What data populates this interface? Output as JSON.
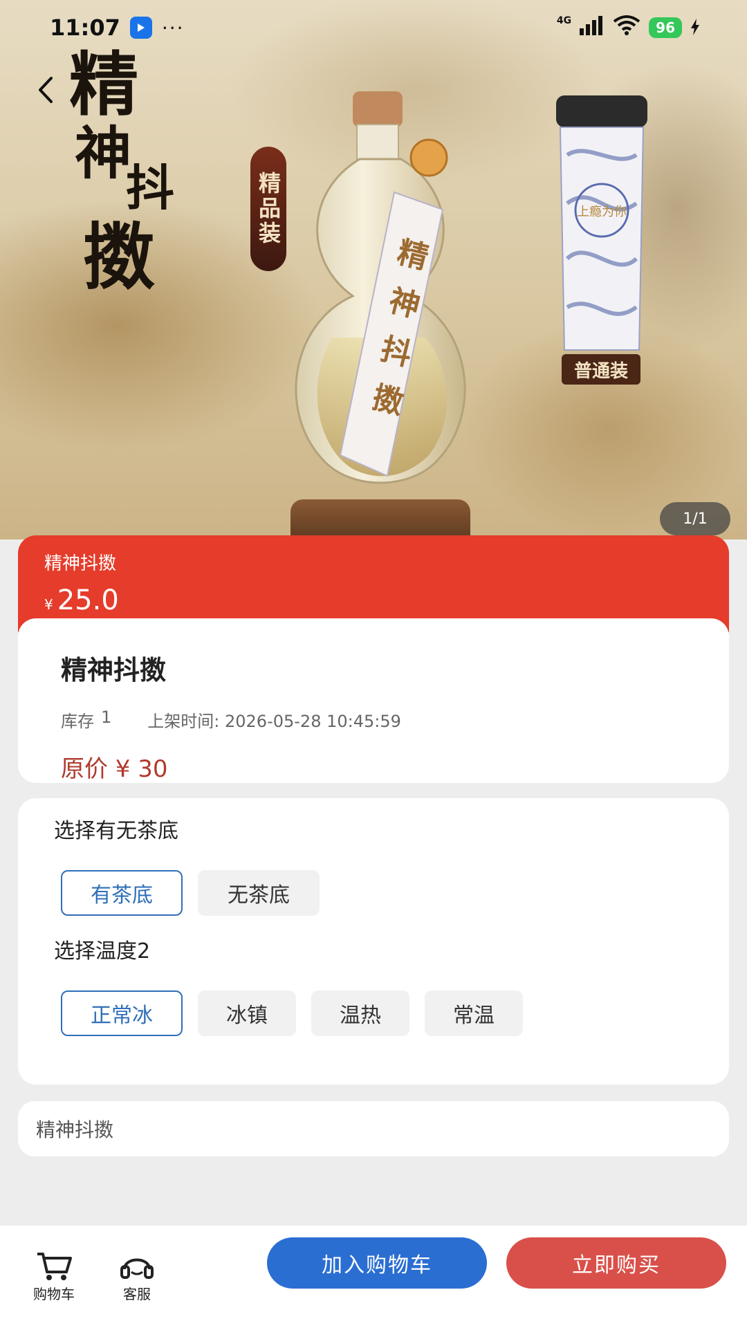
{
  "status_bar": {
    "time": "11:07",
    "dots": "···",
    "network": "4G",
    "battery": "96"
  },
  "hero": {
    "calligraphy_title": [
      "精",
      "神",
      "抖",
      "擞"
    ],
    "premium_tag": "精品装",
    "normal_tag": "普通装",
    "image_counter": "1/1"
  },
  "price_banner": {
    "name": "精神抖擞",
    "currency": "¥",
    "price": "25.0"
  },
  "product": {
    "title": "精神抖擞",
    "stock_label": "库存",
    "stock_value": "1",
    "listing_time": "上架时间: 2026-05-28 10:45:59",
    "original_price": "原价 ¥ 30"
  },
  "options": {
    "tea_base": {
      "title": "选择有无茶底",
      "choices": [
        "有茶底",
        "无茶底"
      ],
      "selected": 0
    },
    "temperature": {
      "title": "选择温度2",
      "choices": [
        "正常冰",
        "冰镇",
        "温热",
        "常温"
      ],
      "selected": 0
    }
  },
  "description": "精神抖擞",
  "bottom_bar": {
    "cart_label": "购物车",
    "service_label": "客服",
    "add_to_cart": "加入购物车",
    "buy_now": "立即购买"
  },
  "colors": {
    "price_banner": "#e53c2b",
    "add_to_cart": "#2a6ed2",
    "buy_now": "#d9504a",
    "selected_chip": "#2f6fb8",
    "original_price": "#b03a2e"
  }
}
